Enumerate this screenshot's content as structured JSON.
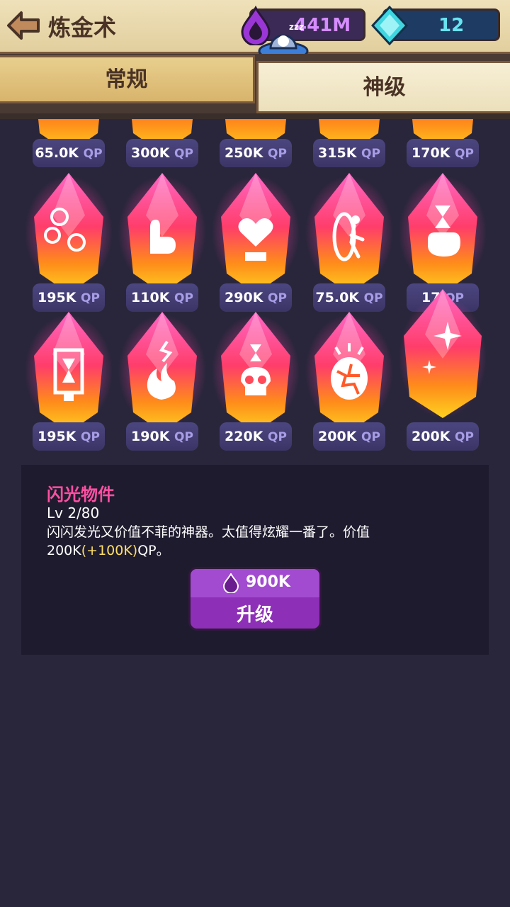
{
  "header": {
    "title": "炼金术",
    "elixir_value": "441M",
    "gem_value": "12"
  },
  "tabs": [
    {
      "label": "常规",
      "active": false
    },
    {
      "label": "神级",
      "active": true
    }
  ],
  "top_row_prices": [
    "65.0K",
    "300K",
    "250K",
    "315K",
    "170K"
  ],
  "items": [
    {
      "price": "195K",
      "icon": "coins-icon"
    },
    {
      "price": "110K",
      "icon": "peace-hand-icon"
    },
    {
      "price": "290K",
      "icon": "heart-box-icon"
    },
    {
      "price": "75.0K",
      "icon": "runner-portal-icon"
    },
    {
      "price": "17",
      "icon": "hourglass-fist-icon"
    },
    {
      "price": "195K",
      "icon": "hourglass-bottle-icon"
    },
    {
      "price": "190K",
      "icon": "fire-icon"
    },
    {
      "price": "220K",
      "icon": "hourglass-skull-icon"
    },
    {
      "price": "200K",
      "icon": "cracked-egg-icon"
    },
    {
      "price": "200K",
      "icon": "sparkle-icon"
    }
  ],
  "qp_unit": "QP",
  "info": {
    "name": "闪光物件",
    "level": "Lv 2/80",
    "description": "闪闪发光又价值不菲的神器。太值得炫耀一番了。价值200K",
    "bonus": "(+100K)",
    "description_end": "QP。"
  },
  "upgrade": {
    "cost": "900K",
    "label": "升级"
  },
  "colors": {
    "background": "#29263b",
    "panel": "#1f1b2e",
    "item_name": "#ff4fa3",
    "upgrade_button": "#8e2fb8"
  }
}
